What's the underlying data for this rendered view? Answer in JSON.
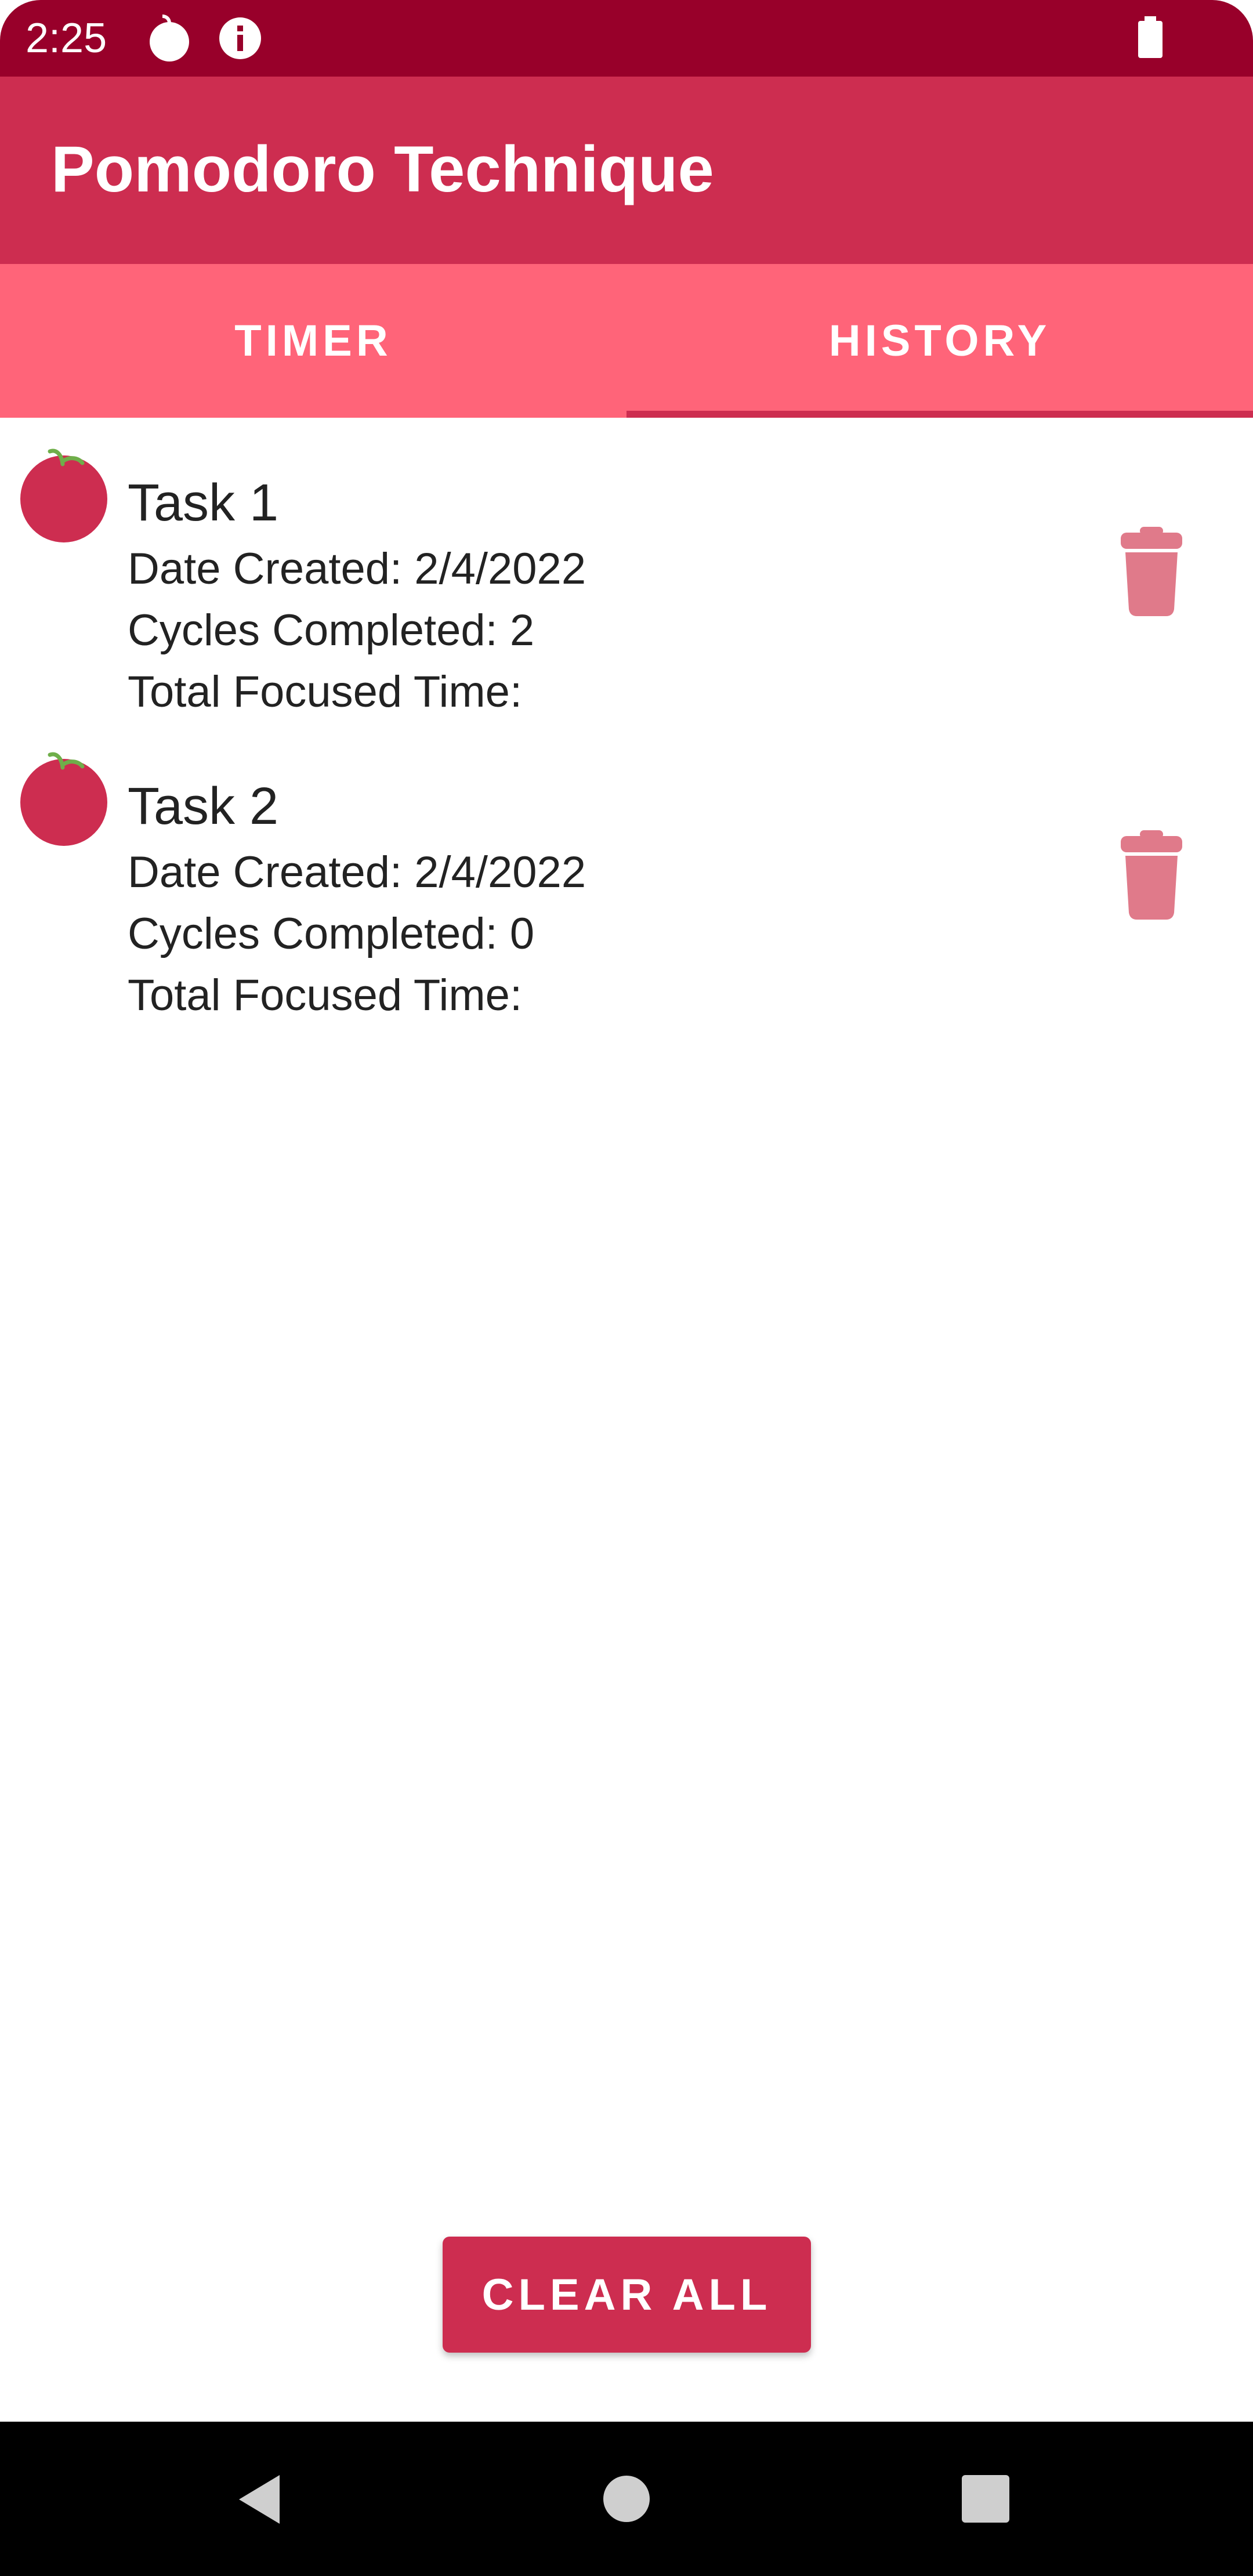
{
  "status_bar": {
    "time": "2:25",
    "icons": [
      "tomato-notification-icon",
      "info-icon",
      "battery-icon"
    ]
  },
  "app_bar": {
    "title": "Pomodoro Technique"
  },
  "tabs": [
    {
      "label": "TIMER",
      "selected": false
    },
    {
      "label": "HISTORY",
      "selected": true
    }
  ],
  "tasks": [
    {
      "name": "Task 1",
      "date_created": "Date Created: 2/4/2022",
      "cycles_completed": "Cycles Completed: 2",
      "total_focused_time": "Total Focused Time:"
    },
    {
      "name": "Task 2",
      "date_created": "Date Created: 2/4/2022",
      "cycles_completed": "Cycles Completed: 0",
      "total_focused_time": "Total Focused Time:"
    }
  ],
  "clear_all_label": "CLEAR ALL",
  "nav_bar": {
    "icons": [
      "back-icon",
      "home-icon",
      "recents-icon"
    ]
  },
  "colors": {
    "status_bar": "#98002a",
    "primary": "#cd2d50",
    "tab_bar": "#ff6479",
    "trash_icon": "#e07a8a",
    "stem": "#6fae4a"
  }
}
